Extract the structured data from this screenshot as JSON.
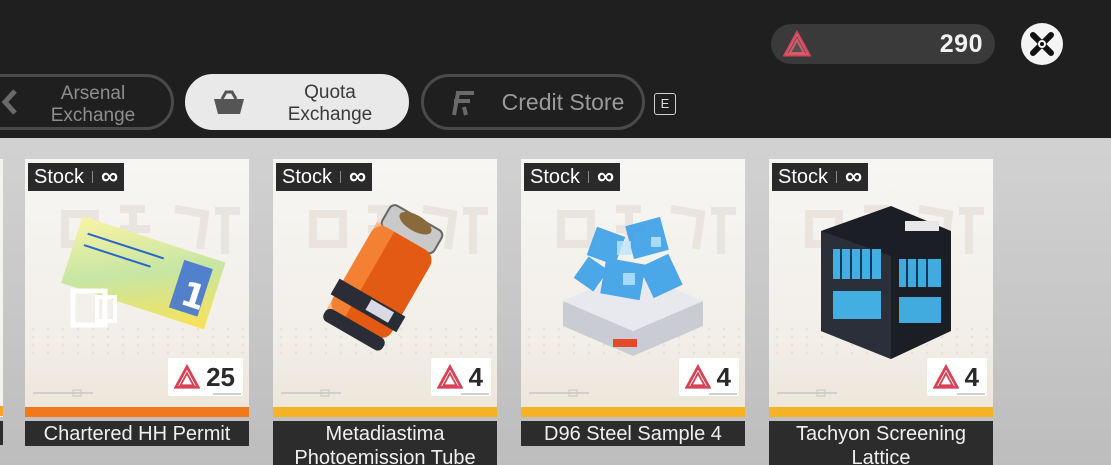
{
  "header": {
    "currency": {
      "icon": "quota-token-icon",
      "value": "290",
      "color": "#d64257"
    },
    "close_icon": "close-x-icon"
  },
  "tabs": [
    {
      "label": "Arsenal\nExchange",
      "icon": "arsenal-icon",
      "active": false
    },
    {
      "label": "Quota\nExchange",
      "icon": "basket-icon",
      "active": true
    },
    {
      "label": "Credit Store",
      "icon": "credit-icon",
      "active": false
    }
  ],
  "key_hint": "E",
  "items": [
    {
      "stock_label": "Stock",
      "stock_value": "∞",
      "price": "25",
      "name": "Chartered HH Permit",
      "rarity_color": "#f07a1a",
      "art": "permit-ticket-icon"
    },
    {
      "stock_label": "Stock",
      "stock_value": "∞",
      "price": "4",
      "name": "Metadiastima\nPhotoemission Tube",
      "rarity_color": "#f5b323",
      "art": "photoemission-tube-icon"
    },
    {
      "stock_label": "Stock",
      "stock_value": "∞",
      "price": "4",
      "name": "D96 Steel Sample 4",
      "rarity_color": "#f5b323",
      "art": "steel-sample-icon"
    },
    {
      "stock_label": "Stock",
      "stock_value": "∞",
      "price": "4",
      "name": "Tachyon Screening\nLattice",
      "rarity_color": "#f5b323",
      "art": "screening-lattice-icon"
    }
  ]
}
